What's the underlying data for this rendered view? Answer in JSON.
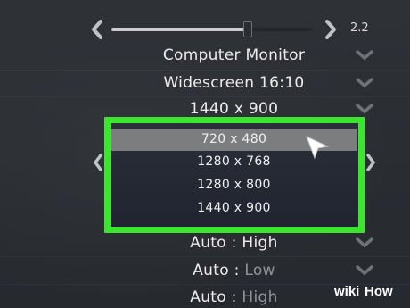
{
  "brightness": {
    "value_label": "2.2",
    "level_fraction": 0.68
  },
  "settings_rows": [
    {
      "value": "Computer Monitor",
      "suffix": ""
    },
    {
      "value": "Widescreen 16:10",
      "suffix": ""
    },
    {
      "value": "1440 x 900",
      "suffix": ""
    }
  ],
  "resolution_dropdown": {
    "options": [
      "720 x 480",
      "1280 x 768",
      "1280 x 800",
      "1440 x 900"
    ],
    "selected": "720 x 480"
  },
  "quality_rows": [
    {
      "prefix": "Auto : ",
      "value": "High",
      "value_dim": false
    },
    {
      "prefix": "Auto : ",
      "value": "Low",
      "value_dim": true
    },
    {
      "prefix": "Auto : ",
      "value": "High",
      "value_dim": true
    }
  ],
  "watermark": {
    "part1": "wiki",
    "part2": "How"
  },
  "colors": {
    "highlight": "#3ce62e",
    "selected_item": "#7c7d7e",
    "text": "#ececec",
    "dim_text": "#8f959b"
  },
  "icons": [
    "chevron-left-icon",
    "chevron-right-icon",
    "chevron-down-icon",
    "mouse-cursor-icon"
  ]
}
